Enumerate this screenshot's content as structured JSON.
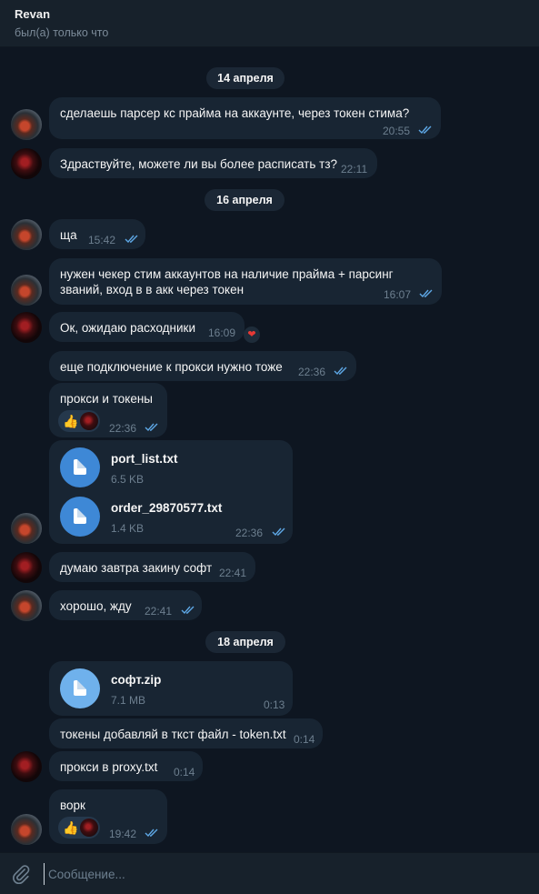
{
  "header": {
    "name": "Revan",
    "status": "был(а) только что"
  },
  "dates": [
    "14 апреля",
    "16 апреля",
    "18 апреля"
  ],
  "messages": [
    {
      "text": "сделаешь парсер кс прайма на аккаунте, через токен стима?",
      "time": "20:55",
      "read": true
    },
    {
      "text": "Здраствуйте, можете ли вы более расписать тз?",
      "time": "22:11"
    },
    {
      "text": "ща",
      "time": "15:42",
      "read": true
    },
    {
      "text": "нужен чекер стим аккаунтов на наличие прайма + парсинг званий, вход в в акк через токен",
      "time": "16:07",
      "read": true
    },
    {
      "text": "Ок, ожидаю расходники",
      "time": "16:09",
      "reaction": "heart"
    },
    {
      "text": "еще подключение к прокси нужно тоже",
      "time": "22:36",
      "read": true
    },
    {
      "text": "прокси и токены",
      "time": "22:36",
      "read": true,
      "reactions": [
        "thumbs-up",
        "avatar"
      ]
    },
    {
      "files": [
        {
          "name": "port_list.txt",
          "size": "6.5 KB"
        },
        {
          "name": "order_29870577.txt",
          "size": "1.4 KB"
        }
      ],
      "time": "22:36",
      "read": true
    },
    {
      "text": "думаю завтра закину софт",
      "time": "22:41"
    },
    {
      "text": "хорошо, жду",
      "time": "22:41",
      "read": true
    },
    {
      "files": [
        {
          "name": "софт.zip",
          "size": "7.1 MB"
        }
      ],
      "time": "0:13"
    },
    {
      "text": "токены добавляй в ткст файл - token.txt",
      "time": "0:14"
    },
    {
      "text": "прокси в proxy.txt",
      "time": "0:14"
    },
    {
      "text": "ворк",
      "time": "19:42",
      "read": true,
      "reactions": [
        "thumbs-up",
        "avatar"
      ]
    }
  ],
  "composer": {
    "placeholder": "Сообщение..."
  },
  "colors": {
    "background": "#0e1621",
    "bubble": "#182533",
    "accent": "#3e88d6",
    "tick": "#5ea8e6"
  }
}
